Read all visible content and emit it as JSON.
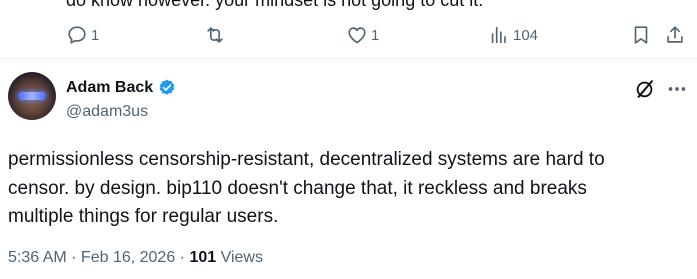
{
  "previous_tweet": {
    "text_fragment": "do know however. your mindset is not going to cut it."
  },
  "action_bar": {
    "reply_count": "1",
    "retweet_count": "",
    "like_count": "1",
    "views_count": "104"
  },
  "tweet": {
    "author_name": "Adam Back",
    "author_handle": "@adam3us",
    "text": "permissionless censorship-resistant, decentralized systems are hard to\ncensor. by design. bip110 doesn't change that, it reckless and breaks\nmultiple things for regular users.",
    "timestamp": "5:36 AM · Feb 16, 2026",
    "separator": " · ",
    "views_count": "101",
    "views_label": " Views"
  },
  "colors": {
    "text_primary": "#0f1419",
    "text_secondary": "#536471",
    "verified_blue": "#1d9bf0",
    "divider": "#eff3f4"
  },
  "icons": {
    "reply": "reply-icon",
    "retweet": "retweet-icon",
    "like": "heart-icon",
    "views": "analytics-icon",
    "bookmark": "bookmark-icon",
    "share": "share-icon",
    "verified": "verified-badge-icon",
    "grok": "grok-icon",
    "more": "more-icon"
  }
}
